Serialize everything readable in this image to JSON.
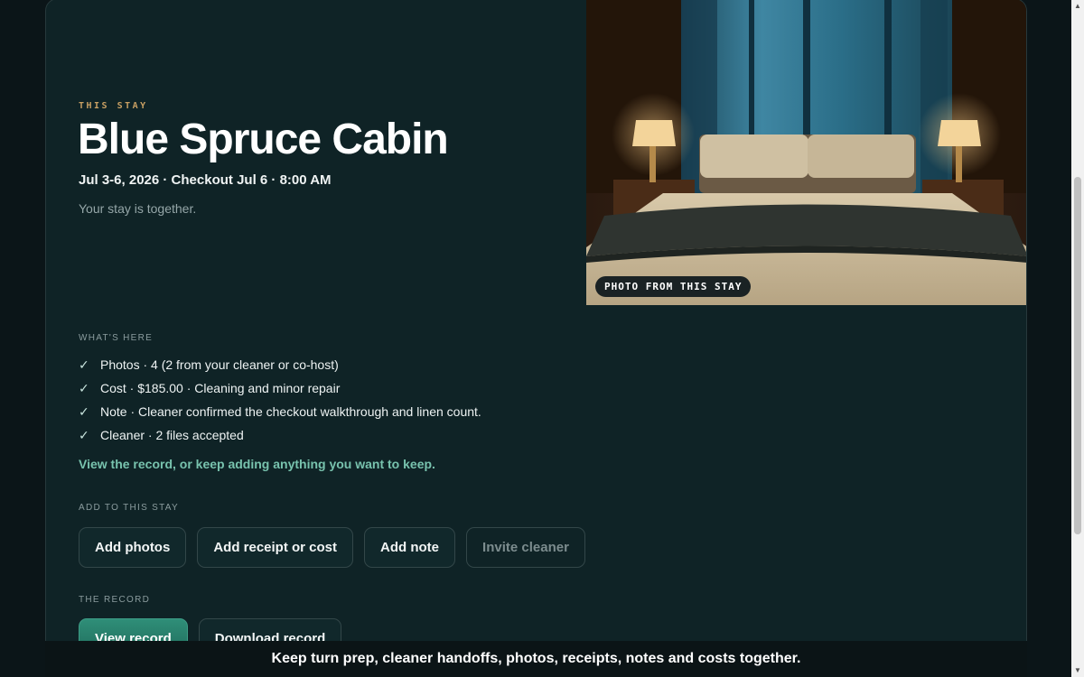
{
  "stay": {
    "eyebrow": "THIS STAY",
    "title": "Blue Spruce Cabin",
    "dates": "Jul 3-6, 2026 · Checkout Jul 6 · 8:00 AM",
    "summary": "Your stay is together.",
    "photo_caption": "PHOTO FROM THIS STAY"
  },
  "whats_here": {
    "label": "WHAT'S HERE",
    "items": [
      "Photos · 4 (2 from your cleaner or co-host)",
      "Cost · $185.00 · Cleaning and minor repair",
      "Note · Cleaner confirmed the checkout walkthrough and linen count.",
      "Cleaner · 2 files accepted"
    ],
    "check_glyph": "✓",
    "cta": "View the record, or keep adding anything you want to keep."
  },
  "add": {
    "label": "ADD TO THIS STAY",
    "buttons": [
      "Add photos",
      "Add receipt or cost",
      "Add note",
      "Invite cleaner"
    ]
  },
  "record": {
    "label": "THE RECORD",
    "view_label": "View record",
    "download_label": "Download record"
  },
  "banner": {
    "text": "Keep turn prep, cleaner handoffs, photos, receipts, notes and costs together."
  },
  "icons": {
    "check": "checkmark-icon",
    "scroll_up": "scroll-up-arrow-icon",
    "scroll_down": "scroll-down-arrow-icon"
  },
  "colors": {
    "card_bg": "#0f2326",
    "eyebrow": "#c9a063",
    "cta_text": "#78c3ae",
    "primary_button": "#2f8e78"
  }
}
